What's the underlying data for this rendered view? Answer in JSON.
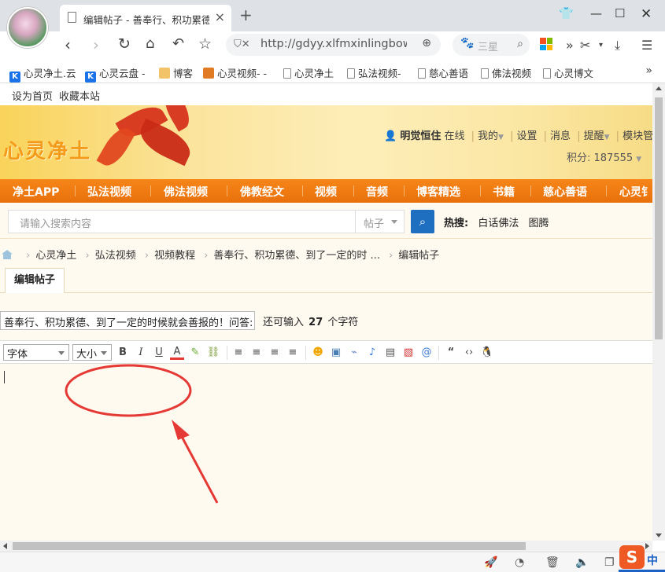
{
  "browser": {
    "tab_title": "编辑帖子 - 善奉行、积功累德",
    "tab_close": "×",
    "new_tab": "+",
    "url": "http://gdyy.xlfmxinlingbow",
    "search_placeholder": "三星",
    "bookmarks": [
      "心灵净土.云",
      "心灵云盘 -",
      "博客",
      "心灵视频- -",
      "心灵净土",
      "弘法视频-",
      "慈心善语",
      "佛法视频",
      "心灵博文"
    ],
    "bookmark_more": "»"
  },
  "site": {
    "top_links": [
      "设为首页",
      "收藏本站"
    ],
    "title": "心灵净土",
    "user_name": "明觉恒住",
    "user_status": "在线",
    "user_menu": [
      "我的",
      "设置",
      "消息",
      "提醒",
      "模块管"
    ],
    "points": "积分: 187555",
    "nav": [
      "净土APP",
      "弘法视频",
      "佛法视频",
      "佛教经文",
      "视频",
      "音频",
      "博客精选",
      "书籍",
      "慈心善语",
      "心灵钅"
    ],
    "search_placeholder": "请输入搜索内容",
    "search_type": "帖子",
    "hot_label": "热搜:",
    "hot_items": [
      "白话佛法",
      "图腾"
    ]
  },
  "breadcrumb": [
    "心灵净土",
    "弘法视频",
    "视频教程",
    "善奉行、积功累德、到了一定的时 ...",
    "编辑帖子"
  ],
  "editor": {
    "tab_label": "编辑帖子",
    "subject_value": "善奉行、积功累德、到了一定的时候就会善报的！问答:",
    "remain_prefix": "还可输入",
    "remain_count": "27",
    "remain_suffix": "个字符",
    "font_select": "字体",
    "size_select": "大小",
    "bold": "B",
    "italic": "I",
    "underline": "U",
    "font_color": "A"
  },
  "colors": {
    "nav_orange": "#f07c12",
    "annotation_red": "#e53935",
    "editor_bg": "#fffaf0"
  }
}
